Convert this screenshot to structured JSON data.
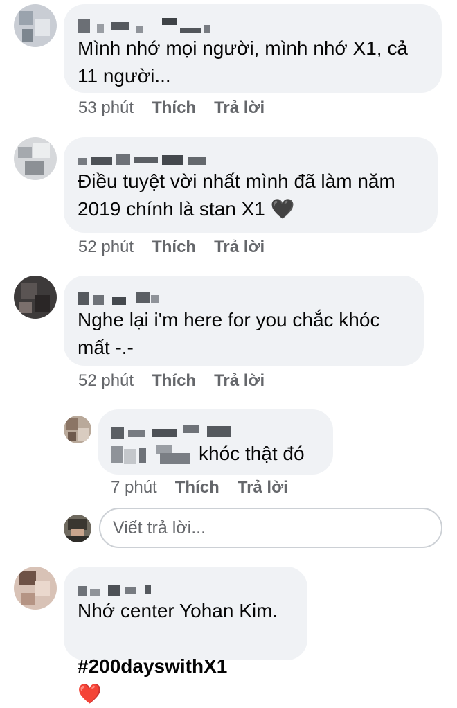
{
  "colors": {
    "bubble": "#f0f2f5",
    "meta": "#65676b",
    "heart": "#e41e3f"
  },
  "comments": [
    {
      "text": "Mình nhớ mọi người, mình nhớ X1, cả\n11 người...",
      "time": "53 phút",
      "like": "Thích",
      "reply": "Trả lời"
    },
    {
      "text": "Điều tuyệt vời nhất mình đã làm năm\n2019 chính là stan X1 🖤",
      "time": "52 phút",
      "like": "Thích",
      "reply": "Trả lời"
    },
    {
      "text": "Nghe lại i'm here for you chắc khóc\nmất -.-",
      "time": "52 phút",
      "like": "Thích",
      "reply": "Trả lời"
    },
    {
      "text": "khóc thật đó",
      "time": "7 phút",
      "like": "Thích",
      "reply": "Trả lời"
    },
    {
      "text_line1": "Nhớ center Yohan Kim.",
      "hashtag": "#200dayswithX1",
      "heart": "❤️"
    }
  ],
  "reply_box": {
    "placeholder": "Viết trả lời..."
  }
}
